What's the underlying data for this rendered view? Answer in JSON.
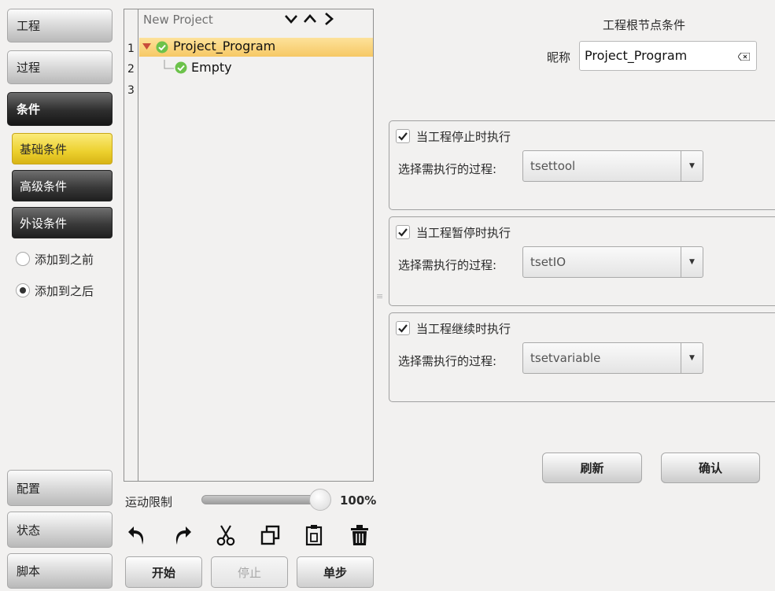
{
  "nav": {
    "project": "工程",
    "process": "过程",
    "condition": "条件",
    "config": "配置",
    "status": "状态",
    "script": "脚本"
  },
  "condition_sub": {
    "basic": "基础条件",
    "advanced": "高级条件",
    "peripheral": "外设条件",
    "add_before": "添加到之前",
    "add_after": "添加到之后",
    "selected_position": "add_after"
  },
  "tree": {
    "header": "New Project",
    "line_numbers": [
      "1",
      "2",
      "3"
    ],
    "nodes": [
      {
        "label": "Project_Program",
        "selected": true
      },
      {
        "label": "Empty",
        "selected": false
      }
    ]
  },
  "motion": {
    "label": "运动限制",
    "value_text": "100%",
    "fraction": 1.0
  },
  "run_buttons": {
    "start": "开始",
    "stop": "停止",
    "step": "单步"
  },
  "right": {
    "title": "工程根节点条件",
    "nickname_label": "昵称",
    "nickname_value": "Project_Program",
    "groups": [
      {
        "title": "当工程停止时执行",
        "checked": true,
        "select_label": "选择需执行的过程:",
        "selected": "tsettool"
      },
      {
        "title": "当工程暂停时执行",
        "checked": true,
        "select_label": "选择需执行的过程:",
        "selected": "tsetIO"
      },
      {
        "title": "当工程继续时执行",
        "checked": true,
        "select_label": "选择需执行的过程:",
        "selected": "tsetvariable"
      }
    ],
    "refresh": "刷新",
    "confirm": "确认"
  },
  "colors": {
    "selected_row": "#f6c865",
    "active_sub": "#ecd02e",
    "node_ok": "#6cc24a"
  }
}
